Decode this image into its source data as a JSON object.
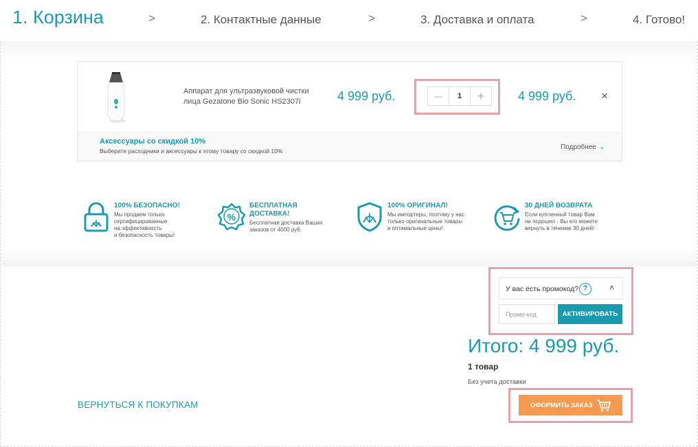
{
  "steps": [
    {
      "label": "1. Корзина"
    },
    {
      "label": "2. Контактные данные"
    },
    {
      "label": "3. Доставка и оплата"
    },
    {
      "label": "4. Готово!"
    }
  ],
  "separator": ">",
  "cart_item": {
    "name": "Аппарат для ультразвуковой чистки лица Gezatone Bio Sonic HS2307i",
    "price": "4 999 руб.",
    "quantity": "1",
    "minus_glyph": "—",
    "plus_glyph": "+",
    "total": "4 999 руб.",
    "remove_glyph": "×"
  },
  "accessories": {
    "title": "Аксессуары со скидкой 10%",
    "subtitle": "Выберите расходники и аксессуары к этому товару со скидкой 10%",
    "more_label": "Подробнее",
    "more_icon_glyph": "⌄"
  },
  "features": [
    {
      "icon": "lock-icon",
      "title": "100% БЕЗОПАСНО!",
      "text": [
        "Мы продаем только",
        "сертифицированные",
        "на эффективность",
        "и безопасность товары!"
      ]
    },
    {
      "icon": "percent-badge-icon",
      "title": [
        "БЕСПЛАТНАЯ",
        "ДОСТАВКА!"
      ],
      "text": [
        "Бесплатная доставка Ваших",
        "заказов от 4000 руб."
      ]
    },
    {
      "icon": "shield-icon",
      "title": "100% ОРИГИНАЛ!",
      "text": [
        "Мы импортеры, поэтому у нас",
        "только оригинальные товары",
        "и оптимальные цены!"
      ]
    },
    {
      "icon": "return-cart-icon",
      "title": "30 ДНЕЙ ВОЗВРАТА",
      "text": [
        "Если купленный товар Вам",
        "не подошел - Вы его можете",
        "вернуть в течение 30 дней!"
      ]
    }
  ],
  "promo": {
    "question": "У вас есть промокод?",
    "help_glyph": "?",
    "collapse_glyph": "˄",
    "placeholder": "Промо-код",
    "activate_label": "АКТИВИРОВАТЬ"
  },
  "totals": {
    "total_label": "Итого: 4 999 руб.",
    "items_count": "1 товар",
    "delivery_note": "Без учета доставки"
  },
  "actions": {
    "back_label": "ВЕРНУТЬСЯ К ПОКУПКАМ",
    "order_label": "ОФОРМИТЬ ЗАКАЗ"
  },
  "colors": {
    "accent": "#1a9ab0",
    "order_button": "#f59a4f",
    "highlight": "#e8a0a8"
  }
}
